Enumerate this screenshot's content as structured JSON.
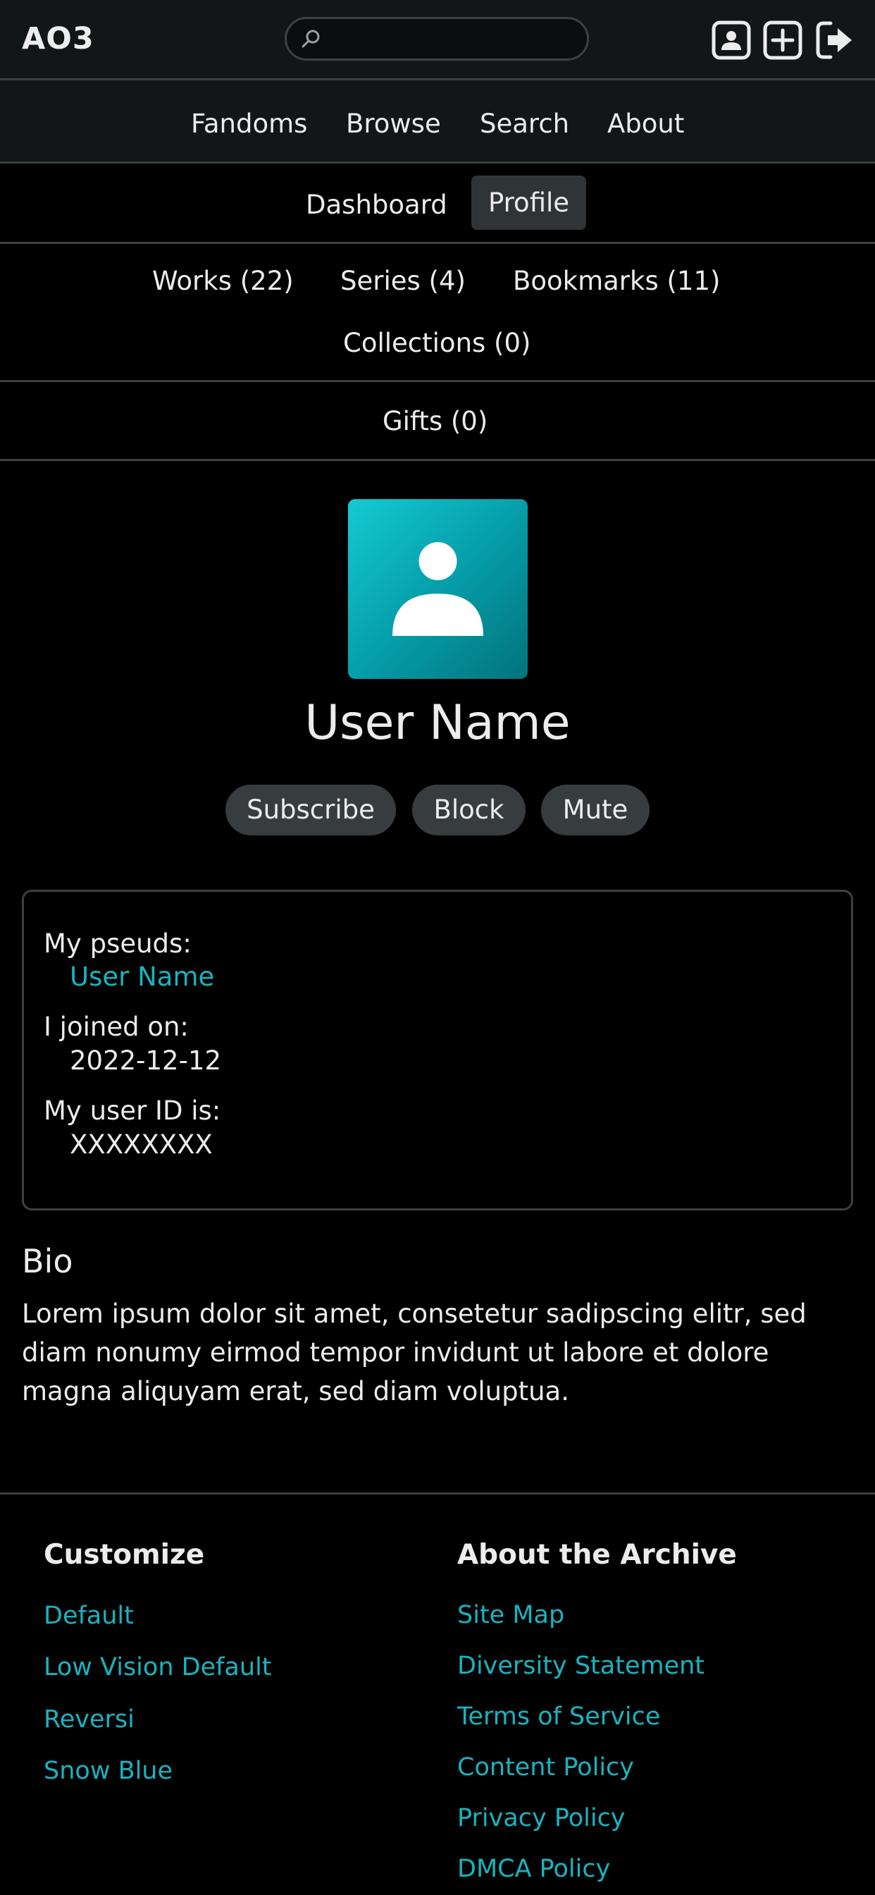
{
  "header": {
    "logo": "AO3",
    "search_placeholder": "",
    "icons": [
      "profile-icon",
      "new-work-icon",
      "logout-icon"
    ]
  },
  "primary_nav": [
    "Fandoms",
    "Browse",
    "Search",
    "About"
  ],
  "sub_nav": {
    "items": [
      "Dashboard",
      "Profile"
    ],
    "active": "Profile"
  },
  "works_nav": [
    "Works (22)",
    "Series (4)",
    "Bookmarks (11)",
    "Collections (0)"
  ],
  "gifts_nav": "Gifts (0)",
  "profile": {
    "name": "User Name",
    "actions": [
      "Subscribe",
      "Block",
      "Mute"
    ]
  },
  "info": {
    "pseuds_label": "My pseuds:",
    "pseuds_value": "User Name",
    "joined_label": "I joined on:",
    "joined_value": "2022-12-12",
    "id_label": "My user ID is:",
    "id_value": "XXXXXXXX"
  },
  "bio": {
    "heading": "Bio",
    "text": "Lorem ipsum dolor sit amet, consetetur sadipscing elitr, sed diam nonumy eirmod tempor invidunt ut labore et dolore magna aliquyam erat, sed diam voluptua."
  },
  "footer": {
    "customize": {
      "heading": "Customize",
      "links": [
        "Default",
        "Low Vision Default",
        "Reversi",
        "Snow Blue"
      ]
    },
    "about": {
      "heading": "About the Archive",
      "links": [
        "Site Map",
        "Diversity Statement",
        "Terms of Service",
        "Content Policy",
        "Privacy Policy",
        "DMCA Policy"
      ]
    }
  },
  "colors": {
    "background": "#000000",
    "header_bg": "#121617",
    "accent": "#19b3c0",
    "pill_bg": "#373c3e",
    "divider": "#3a3f41"
  }
}
